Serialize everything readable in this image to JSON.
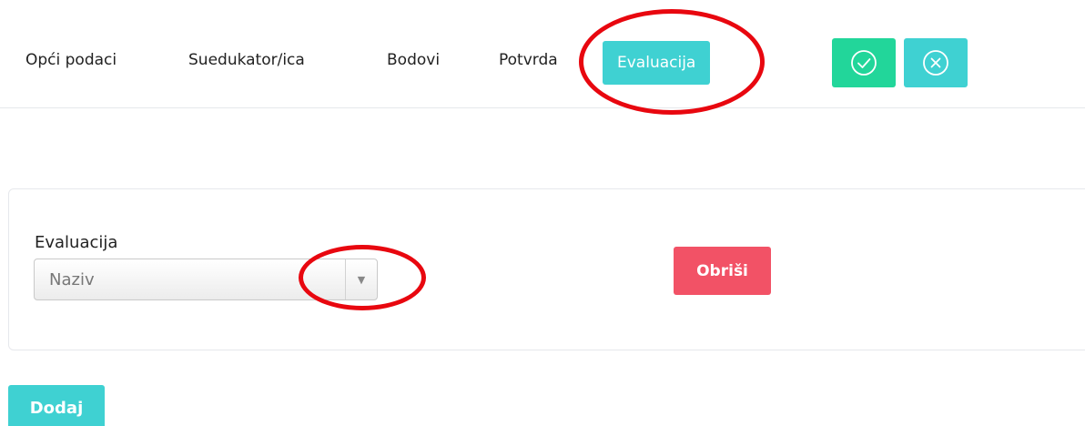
{
  "tabs": [
    {
      "label": "Opći podaci",
      "active": false
    },
    {
      "label": "Suedukator/ica",
      "active": false
    },
    {
      "label": "Bodovi",
      "active": false
    },
    {
      "label": "Potvrda",
      "active": false
    },
    {
      "label": "Evaluacija",
      "active": true
    }
  ],
  "actions": {
    "confirm_icon": "check-circle-icon",
    "cancel_icon": "x-circle-icon"
  },
  "form": {
    "label": "Evaluacija",
    "select_value": "Naziv",
    "delete_label": "Obriši"
  },
  "add_label": "Dodaj",
  "colors": {
    "teal": "#3fd1d2",
    "green": "#22d69a",
    "red": "#f25266",
    "annotation": "#e8070f"
  }
}
